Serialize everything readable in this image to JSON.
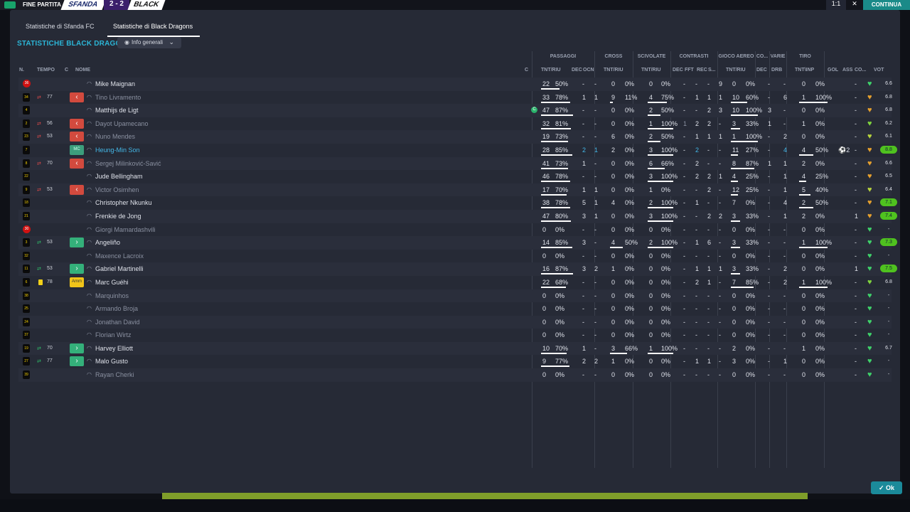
{
  "topbar": {
    "end_label": "FINE PARTITA",
    "home_team": "SFANDA",
    "score": "2 - 2",
    "away_team": "BLACK",
    "zoom": "1:1",
    "close": "✕",
    "continue": "CONTINUA"
  },
  "tabs": [
    "Statistiche di Sfanda FC",
    "Statistiche di Black Dragons"
  ],
  "active_tab": 1,
  "title": "STATISTICHE BLACK DRAGONS",
  "dropdown": {
    "label": "Info generali"
  },
  "group_headers": [
    "PASSAGGI",
    "CROSS",
    "SCIVOLATE",
    "CONTRASTI",
    "GIOCO AEREO",
    "CO...",
    "VARIE",
    "TIRO"
  ],
  "column_headers": {
    "num": "N.",
    "time": "TEMPO",
    "c": "C",
    "name": "NOME",
    "capt": "C",
    "pass": "TNT/RIU",
    "pass_dec": "DEC",
    "pass_ocn": "OCN",
    "cross": "TNT/RIU",
    "tackle": "TNT/RIU",
    "con_dec": "DEC",
    "con_fft": "FFT",
    "con_rec": "REC",
    "con_s": "S...",
    "aer": "TNT/RIU",
    "co_dec": "DEC",
    "drb": "DRB",
    "shot": "TNT\\INP",
    "gol": "GOL",
    "ass": "ASS",
    "con": "CO...",
    "vote": "VOT"
  },
  "players": [
    {
      "num": "36",
      "gk": true,
      "arrow": "",
      "min": "",
      "sub": "",
      "name": "Mike Maignan",
      "dim": false,
      "capt": false,
      "pass": [
        "22",
        "50%"
      ],
      "dec": "-",
      "ocn": "-",
      "cross": [
        "0",
        "0%"
      ],
      "tack": [
        "0",
        "0%"
      ],
      "c1": "-",
      "c2": "-",
      "c3": "-",
      "c4": "9",
      "aer": [
        "0",
        "0%"
      ],
      "codec": "-",
      "drb": "-",
      "shot": [
        "0",
        "0%"
      ],
      "gol": "",
      "ass": "-",
      "heart": "#3fd16a",
      "vote": "6.6",
      "vgreen": false
    },
    {
      "num": "34",
      "gk": false,
      "arrow": "out",
      "min": "77",
      "sub": "out",
      "name": "Tino Livramento",
      "dim": true,
      "capt": false,
      "pass": [
        "33",
        "78%"
      ],
      "dec": "1",
      "ocn": "1",
      "cross": [
        "9",
        "11%"
      ],
      "tack": [
        "4",
        "75%"
      ],
      "c1": "-",
      "c2": "1",
      "c3": "1",
      "c4": "1",
      "aer": [
        "10",
        "60%"
      ],
      "codec": "-",
      "drb": "6",
      "shot": [
        "1",
        "100%"
      ],
      "gol": "",
      "ass": "-",
      "heart": "#e5a02e",
      "vote": "6.8",
      "vgreen": false
    },
    {
      "num": "4",
      "gk": false,
      "arrow": "",
      "min": "",
      "sub": "",
      "name": "Matthijs de Ligt",
      "dim": false,
      "capt": true,
      "pass": [
        "47",
        "87%"
      ],
      "dec": "-",
      "ocn": "-",
      "cross": [
        "0",
        "0%"
      ],
      "tack": [
        "2",
        "50%"
      ],
      "c1": "-",
      "c2": "-",
      "c3": "2",
      "c4": "3",
      "aer": [
        "10",
        "100%"
      ],
      "codec": "3",
      "drb": "-",
      "shot": [
        "0",
        "0%"
      ],
      "gol": "",
      "ass": "-",
      "heart": "#e5a02e",
      "vote": "6.8",
      "vgreen": false
    },
    {
      "num": "2",
      "gk": false,
      "arrow": "out",
      "min": "56",
      "sub": "out",
      "name": "Dayot Upamecano",
      "dim": true,
      "capt": false,
      "pass": [
        "32",
        "81%"
      ],
      "dec": "-",
      "ocn": "-",
      "cross": [
        "0",
        "0%"
      ],
      "tack": [
        "1",
        "100%"
      ],
      "c1": "1",
      "c2": "2",
      "c3": "2",
      "c4": "-",
      "aer": [
        "3",
        "33%"
      ],
      "codec": "1",
      "drb": "-",
      "shot": [
        "1",
        "0%"
      ],
      "gol": "",
      "ass": "-",
      "heart": "#7fd33e",
      "vote": "6.2",
      "vgreen": false
    },
    {
      "num": "23",
      "gk": false,
      "arrow": "out",
      "min": "53",
      "sub": "out",
      "name": "Nuno Mendes",
      "dim": true,
      "capt": false,
      "pass": [
        "19",
        "73%"
      ],
      "dec": "-",
      "ocn": "-",
      "cross": [
        "6",
        "0%"
      ],
      "tack": [
        "2",
        "50%"
      ],
      "c1": "-",
      "c2": "1",
      "c3": "1",
      "c4": "1",
      "aer": [
        "1",
        "100%"
      ],
      "codec": "-",
      "drb": "2",
      "shot": [
        "0",
        "0%"
      ],
      "gol": "",
      "ass": "-",
      "heart": "#b7d33e",
      "vote": "6.1",
      "vgreen": false
    },
    {
      "num": "7",
      "gk": false,
      "arrow": "",
      "min": "",
      "sub": "pos",
      "pos": "MC",
      "name": "Heung-Min Son",
      "dim": false,
      "son": true,
      "capt": false,
      "pass": [
        "28",
        "85%"
      ],
      "dec": "2",
      "ocn": "1",
      "cross": [
        "2",
        "0%"
      ],
      "tack": [
        "3",
        "100%"
      ],
      "c1": "-",
      "c2": "2",
      "c3": "-",
      "c4": "-",
      "aer": [
        "11",
        "27%"
      ],
      "codec": "-",
      "drb": "4",
      "shot": [
        "4",
        "50%"
      ],
      "gol": "⚽2",
      "ass": "-",
      "heart": "#e5a02e",
      "vote": "8.8",
      "vgreen": true
    },
    {
      "num": "8",
      "gk": false,
      "arrow": "out",
      "min": "70",
      "sub": "out",
      "name": "Sergej Milinković-Savić",
      "dim": true,
      "capt": false,
      "pass": [
        "41",
        "73%"
      ],
      "dec": "1",
      "ocn": "-",
      "cross": [
        "0",
        "0%"
      ],
      "tack": [
        "6",
        "66%"
      ],
      "c1": "-",
      "c2": "2",
      "c3": "-",
      "c4": "-",
      "aer": [
        "8",
        "87%"
      ],
      "codec": "1",
      "drb": "1",
      "shot": [
        "2",
        "0%"
      ],
      "gol": "",
      "ass": "-",
      "heart": "#e5a02e",
      "vote": "6.6",
      "vgreen": false
    },
    {
      "num": "22",
      "gk": false,
      "arrow": "",
      "min": "",
      "sub": "",
      "name": "Jude Bellingham",
      "dim": false,
      "capt": false,
      "pass": [
        "46",
        "78%"
      ],
      "dec": "-",
      "ocn": "-",
      "cross": [
        "0",
        "0%"
      ],
      "tack": [
        "3",
        "100%"
      ],
      "c1": "-",
      "c2": "2",
      "c3": "2",
      "c4": "1",
      "aer": [
        "4",
        "25%"
      ],
      "codec": "-",
      "drb": "1",
      "shot": [
        "4",
        "25%"
      ],
      "gol": "",
      "ass": "-",
      "heart": "#e5a02e",
      "vote": "6.5",
      "vgreen": false
    },
    {
      "num": "9",
      "gk": false,
      "arrow": "out",
      "min": "53",
      "sub": "out",
      "name": "Victor Osimhen",
      "dim": true,
      "capt": false,
      "pass": [
        "17",
        "70%"
      ],
      "dec": "1",
      "ocn": "1",
      "cross": [
        "0",
        "0%"
      ],
      "tack": [
        "1",
        "0%"
      ],
      "c1": "-",
      "c2": "-",
      "c3": "2",
      "c4": "-",
      "aer": [
        "12",
        "25%"
      ],
      "codec": "-",
      "drb": "1",
      "shot": [
        "5",
        "40%"
      ],
      "gol": "",
      "ass": "-",
      "heart": "#b7d33e",
      "vote": "6.4",
      "vgreen": false
    },
    {
      "num": "18",
      "gk": false,
      "arrow": "",
      "min": "",
      "sub": "",
      "name": "Christopher Nkunku",
      "dim": false,
      "capt": false,
      "pass": [
        "38",
        "78%"
      ],
      "dec": "5",
      "ocn": "1",
      "cross": [
        "4",
        "0%"
      ],
      "tack": [
        "2",
        "100%"
      ],
      "c1": "-",
      "c2": "1",
      "c3": "-",
      "c4": "-",
      "aer": [
        "7",
        "0%"
      ],
      "codec": "-",
      "drb": "4",
      "shot": [
        "2",
        "50%"
      ],
      "gol": "",
      "ass": "-",
      "heart": "#e5a02e",
      "vote": "7.1",
      "vgreen": true
    },
    {
      "num": "21",
      "gk": false,
      "arrow": "",
      "min": "",
      "sub": "",
      "name": "Frenkie de Jong",
      "dim": false,
      "capt": false,
      "pass": [
        "47",
        "80%"
      ],
      "dec": "3",
      "ocn": "1",
      "cross": [
        "0",
        "0%"
      ],
      "tack": [
        "3",
        "100%"
      ],
      "c1": "-",
      "c2": "-",
      "c3": "2",
      "c4": "2",
      "aer": [
        "3",
        "33%"
      ],
      "codec": "-",
      "drb": "1",
      "shot": [
        "2",
        "0%"
      ],
      "gol": "",
      "ass": "1",
      "heart": "#e5a02e",
      "vote": "7.4",
      "vgreen": true
    },
    {
      "num": "30",
      "gk": true,
      "arrow": "",
      "min": "",
      "sub": "",
      "name": "Giorgi Mamardashvili",
      "dim": true,
      "capt": false,
      "pass": [
        "0",
        "0%"
      ],
      "dec": "-",
      "ocn": "-",
      "cross": [
        "0",
        "0%"
      ],
      "tack": [
        "0",
        "0%"
      ],
      "c1": "-",
      "c2": "-",
      "c3": "-",
      "c4": "-",
      "aer": [
        "0",
        "0%"
      ],
      "codec": "-",
      "drb": "-",
      "shot": [
        "0",
        "0%"
      ],
      "gol": "",
      "ass": "-",
      "heart": "#3fd16a",
      "vote": "-",
      "vgreen": false
    },
    {
      "num": "3",
      "gk": false,
      "arrow": "in",
      "min": "53",
      "sub": "in",
      "name": "Angeliño",
      "dim": false,
      "capt": false,
      "pass": [
        "14",
        "85%"
      ],
      "dec": "3",
      "ocn": "-",
      "cross": [
        "4",
        "50%"
      ],
      "tack": [
        "2",
        "100%"
      ],
      "c1": "-",
      "c2": "1",
      "c3": "6",
      "c4": "-",
      "aer": [
        "3",
        "33%"
      ],
      "codec": "-",
      "drb": "-",
      "shot": [
        "1",
        "100%"
      ],
      "gol": "",
      "ass": "-",
      "heart": "#3fd16a",
      "vote": "7.3",
      "vgreen": true
    },
    {
      "num": "32",
      "gk": false,
      "arrow": "",
      "min": "",
      "sub": "",
      "name": "Maxence Lacroix",
      "dim": true,
      "capt": false,
      "pass": [
        "0",
        "0%"
      ],
      "dec": "-",
      "ocn": "-",
      "cross": [
        "0",
        "0%"
      ],
      "tack": [
        "0",
        "0%"
      ],
      "c1": "-",
      "c2": "-",
      "c3": "-",
      "c4": "-",
      "aer": [
        "0",
        "0%"
      ],
      "codec": "-",
      "drb": "-",
      "shot": [
        "0",
        "0%"
      ],
      "gol": "",
      "ass": "-",
      "heart": "#3fd16a",
      "vote": "-",
      "vgreen": false
    },
    {
      "num": "11",
      "gk": false,
      "arrow": "in",
      "min": "53",
      "sub": "in",
      "name": "Gabriel Martinelli",
      "dim": false,
      "capt": false,
      "pass": [
        "16",
        "87%"
      ],
      "dec": "3",
      "ocn": "2",
      "cross": [
        "1",
        "0%"
      ],
      "tack": [
        "0",
        "0%"
      ],
      "c1": "-",
      "c2": "1",
      "c3": "1",
      "c4": "1",
      "aer": [
        "3",
        "33%"
      ],
      "codec": "-",
      "drb": "2",
      "shot": [
        "0",
        "0%"
      ],
      "gol": "",
      "ass": "1",
      "heart": "#3fd16a",
      "vote": "7.5",
      "vgreen": true
    },
    {
      "num": "6",
      "gk": false,
      "arrow": "card",
      "min": "78",
      "sub": "pos",
      "pos": "Amm",
      "amm": true,
      "name": "Marc Guéhi",
      "dim": false,
      "capt": false,
      "pass": [
        "22",
        "68%"
      ],
      "dec": "-",
      "ocn": "-",
      "cross": [
        "0",
        "0%"
      ],
      "tack": [
        "0",
        "0%"
      ],
      "c1": "-",
      "c2": "2",
      "c3": "1",
      "c4": "-",
      "aer": [
        "7",
        "85%"
      ],
      "codec": "-",
      "drb": "2",
      "shot": [
        "1",
        "100%"
      ],
      "gol": "",
      "ass": "-",
      "heart": "#7fd33e",
      "vote": "6.8",
      "vgreen": false
    },
    {
      "num": "38",
      "gk": false,
      "arrow": "",
      "min": "",
      "sub": "",
      "name": "Marquinhos",
      "dim": true,
      "capt": false,
      "pass": [
        "0",
        "0%"
      ],
      "dec": "-",
      "ocn": "-",
      "cross": [
        "0",
        "0%"
      ],
      "tack": [
        "0",
        "0%"
      ],
      "c1": "-",
      "c2": "-",
      "c3": "-",
      "c4": "-",
      "aer": [
        "0",
        "0%"
      ],
      "codec": "-",
      "drb": "-",
      "shot": [
        "0",
        "0%"
      ],
      "gol": "",
      "ass": "-",
      "heart": "#3fd16a",
      "vote": "-",
      "vgreen": false
    },
    {
      "num": "25",
      "gk": false,
      "arrow": "",
      "min": "",
      "sub": "",
      "name": "Armando Broja",
      "dim": true,
      "capt": false,
      "pass": [
        "0",
        "0%"
      ],
      "dec": "-",
      "ocn": "-",
      "cross": [
        "0",
        "0%"
      ],
      "tack": [
        "0",
        "0%"
      ],
      "c1": "-",
      "c2": "-",
      "c3": "-",
      "c4": "-",
      "aer": [
        "0",
        "0%"
      ],
      "codec": "-",
      "drb": "-",
      "shot": [
        "0",
        "0%"
      ],
      "gol": "",
      "ass": "-",
      "heart": "#3fd16a",
      "vote": "-",
      "vgreen": false
    },
    {
      "num": "24",
      "gk": false,
      "arrow": "",
      "min": "",
      "sub": "",
      "name": "Jonathan David",
      "dim": true,
      "capt": false,
      "pass": [
        "0",
        "0%"
      ],
      "dec": "-",
      "ocn": "-",
      "cross": [
        "0",
        "0%"
      ],
      "tack": [
        "0",
        "0%"
      ],
      "c1": "-",
      "c2": "-",
      "c3": "-",
      "c4": "-",
      "aer": [
        "0",
        "0%"
      ],
      "codec": "-",
      "drb": "-",
      "shot": [
        "0",
        "0%"
      ],
      "gol": "",
      "ass": "-",
      "heart": "#3fd16a",
      "vote": "-",
      "vgreen": false
    },
    {
      "num": "37",
      "gk": false,
      "arrow": "",
      "min": "",
      "sub": "",
      "name": "Florian Wirtz",
      "dim": true,
      "capt": false,
      "pass": [
        "0",
        "0%"
      ],
      "dec": "-",
      "ocn": "-",
      "cross": [
        "0",
        "0%"
      ],
      "tack": [
        "0",
        "0%"
      ],
      "c1": "-",
      "c2": "-",
      "c3": "-",
      "c4": "-",
      "aer": [
        "0",
        "0%"
      ],
      "codec": "-",
      "drb": "-",
      "shot": [
        "0",
        "0%"
      ],
      "gol": "",
      "ass": "-",
      "heart": "#3fd16a",
      "vote": "-",
      "vgreen": false
    },
    {
      "num": "19",
      "gk": false,
      "arrow": "in",
      "min": "70",
      "sub": "in",
      "name": "Harvey Elliott",
      "dim": false,
      "capt": false,
      "pass": [
        "10",
        "70%"
      ],
      "dec": "1",
      "ocn": "-",
      "cross": [
        "3",
        "66%"
      ],
      "tack": [
        "1",
        "100%"
      ],
      "c1": "-",
      "c2": "-",
      "c3": "-",
      "c4": "-",
      "aer": [
        "2",
        "0%"
      ],
      "codec": "-",
      "drb": "-",
      "shot": [
        "1",
        "0%"
      ],
      "gol": "",
      "ass": "-",
      "heart": "#3fd16a",
      "vote": "6.7",
      "vgreen": false
    },
    {
      "num": "27",
      "gk": false,
      "arrow": "in",
      "min": "77",
      "sub": "in",
      "name": "Malo Gusto",
      "dim": false,
      "capt": false,
      "pass": [
        "9",
        "77%"
      ],
      "dec": "2",
      "ocn": "2",
      "cross": [
        "1",
        "0%"
      ],
      "tack": [
        "0",
        "0%"
      ],
      "c1": "-",
      "c2": "1",
      "c3": "1",
      "c4": "-",
      "aer": [
        "3",
        "0%"
      ],
      "codec": "-",
      "drb": "1",
      "shot": [
        "0",
        "0%"
      ],
      "gol": "",
      "ass": "-",
      "heart": "#3fd16a",
      "vote": "-",
      "vgreen": false
    },
    {
      "num": "39",
      "gk": false,
      "arrow": "",
      "min": "",
      "sub": "",
      "name": "Rayan Cherki",
      "dim": true,
      "capt": false,
      "pass": [
        "0",
        "0%"
      ],
      "dec": "-",
      "ocn": "-",
      "cross": [
        "0",
        "0%"
      ],
      "tack": [
        "0",
        "0%"
      ],
      "c1": "-",
      "c2": "-",
      "c3": "-",
      "c4": "-",
      "aer": [
        "0",
        "0%"
      ],
      "codec": "-",
      "drb": "-",
      "shot": [
        "0",
        "0%"
      ],
      "gol": "",
      "ass": "-",
      "heart": "#3fd16a",
      "vote": "-",
      "vgreen": false
    }
  ],
  "ok_button": "Ok"
}
